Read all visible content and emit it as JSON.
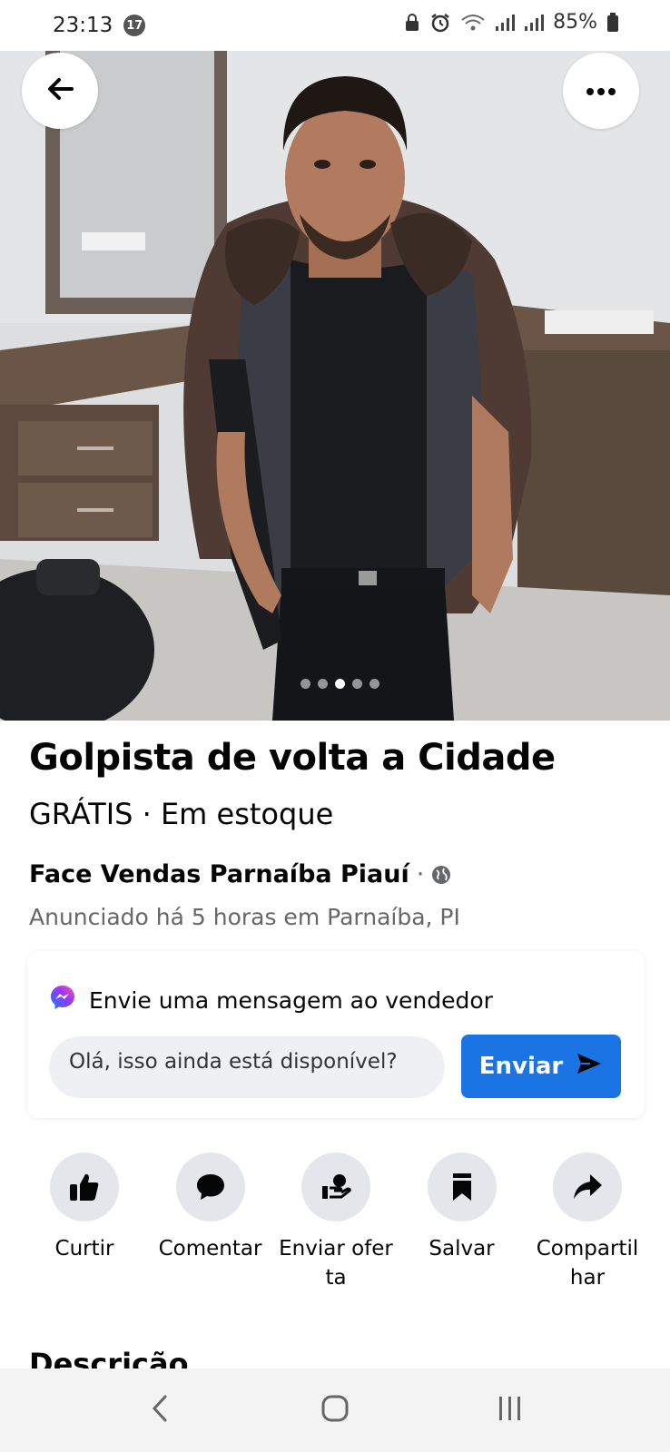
{
  "status_bar": {
    "time": "23:13",
    "notification_count": "17",
    "battery": "85%"
  },
  "listing": {
    "photo_alt": "Man in black shirt with brown cardigan over shoulders",
    "carousel": {
      "count": 5,
      "active_index": 2
    },
    "title": "Golpista de volta a Cidade",
    "price_line": "GRÁTIS · Em estoque",
    "seller_group": "Face Vendas  Parnaíba Piauí",
    "seller_separator": "·",
    "posted": "Anunciado há 5 horas em Parnaíba, PI"
  },
  "message": {
    "header": "Envie uma mensagem ao vendedor",
    "input_value": "Olá, isso ainda está disponível?",
    "send_label": "Enviar"
  },
  "actions": [
    {
      "label": "Curtir",
      "icon": "thumbs-up-icon"
    },
    {
      "label": "Comentar",
      "icon": "comment-icon"
    },
    {
      "label": "Enviar oferta",
      "icon": "offer-icon"
    },
    {
      "label": "Salvar",
      "icon": "bookmark-icon"
    },
    {
      "label": "Compartilhar",
      "icon": "share-icon"
    }
  ],
  "description_heading": "Descrição",
  "colors": {
    "accent": "#1b74e4",
    "action_bg": "#e4e6eb",
    "secondary_text": "#65676b"
  }
}
